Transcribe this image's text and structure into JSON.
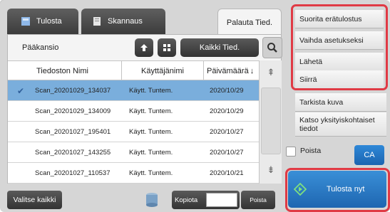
{
  "tabs": {
    "print_label": "Tulosta",
    "scan_label": "Skannaus",
    "recall_label": "Palauta Tied."
  },
  "toolbar": {
    "folder_label": "Pääkansio",
    "all_files_label": "Kaikki Tied."
  },
  "table": {
    "headers": {
      "name": "Tiedoston Nimi",
      "user": "Käyttäjänimi",
      "date": "Päivämäärä"
    },
    "rows": [
      {
        "name": "Scan_20201029_134037",
        "user": "Käytt. Tuntem.",
        "date": "2020/10/29",
        "selected": true
      },
      {
        "name": "Scan_20201029_134009",
        "user": "Käytt. Tuntem.",
        "date": "2020/10/29",
        "selected": false
      },
      {
        "name": "Scan_20201027_195401",
        "user": "Käytt. Tuntem.",
        "date": "2020/10/27",
        "selected": false
      },
      {
        "name": "Scan_20201027_143255",
        "user": "Käytt. Tuntem.",
        "date": "2020/10/27",
        "selected": false
      },
      {
        "name": "Scan_20201027_110537",
        "user": "Käytt. Tuntem.",
        "date": "2020/10/21",
        "selected": false
      }
    ]
  },
  "bottom": {
    "select_all_label": "Valitse kaikki",
    "copies_label": "Kopiota",
    "copies_value": "",
    "delete_label": "Poista"
  },
  "right_panel": {
    "actions": [
      "Suorita erätulostus",
      "Vaihda asetukseksi",
      "Lähetä",
      "Siirrä"
    ],
    "check_image_label": "Tarkista kuva",
    "view_details_label": "Katso yksityiskohtaiset tiedot",
    "delete_check_label": "Poista",
    "ca_label": "CA",
    "print_now_label": "Tulosta nyt"
  },
  "colors": {
    "selected_row": "#7aaedc",
    "highlight_border": "#e03a45",
    "primary_blue": "#1e66b1",
    "dark_button": "#3c3c3c"
  }
}
